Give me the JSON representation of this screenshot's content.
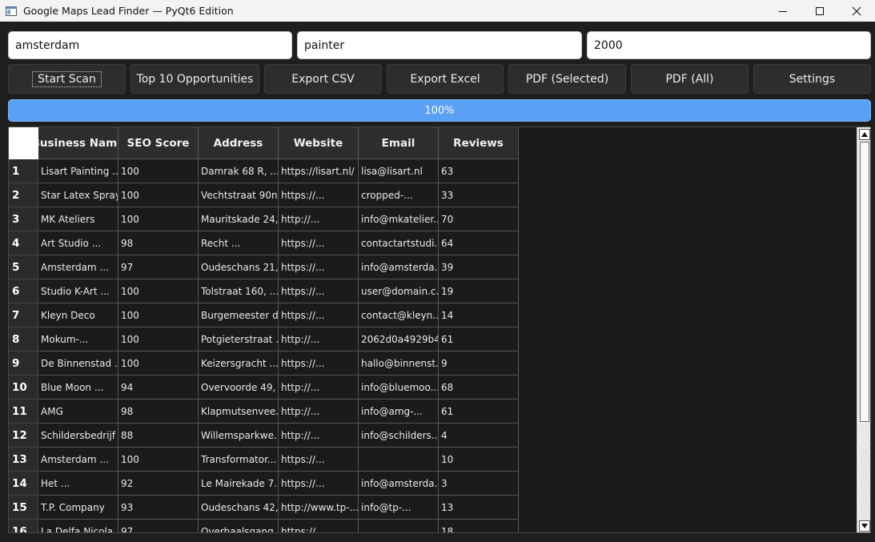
{
  "window": {
    "title": "Google Maps Lead Finder — PyQt6 Edition"
  },
  "inputs": {
    "location": "amsterdam",
    "keyword": "painter",
    "limit": "2000"
  },
  "toolbar": {
    "start_scan": "Start Scan",
    "top10": "Top 10 Opportunities",
    "export_csv": "Export CSV",
    "export_excel": "Export Excel",
    "pdf_selected": "PDF (Selected)",
    "pdf_all": "PDF (All)",
    "settings": "Settings"
  },
  "progress": {
    "value": 1.0,
    "label": "100%"
  },
  "table": {
    "columns": [
      "Business Name",
      "SEO Score",
      "Address",
      "Website",
      "Email",
      "Reviews"
    ],
    "rows": [
      {
        "n": "1",
        "name": "Lisart Painting ...",
        "seo": "100",
        "address": "Damrak 68 R, ...",
        "website": "https://lisart.nl/",
        "email": "lisa@lisart.nl",
        "reviews": "63"
      },
      {
        "n": "2",
        "name": "Star Latex Spray",
        "seo": "100",
        "address": "Vechtstraat 90n,...",
        "website": "https://...",
        "email": "cropped-...",
        "reviews": "33"
      },
      {
        "n": "3",
        "name": "MK Ateliers",
        "seo": "100",
        "address": "Mauritskade 24,...",
        "website": "http://...",
        "email": "info@mkatelier....",
        "reviews": "70"
      },
      {
        "n": "4",
        "name": "Art Studio ...",
        "seo": "98",
        "address": "Recht ...",
        "website": "https://...",
        "email": "contactartstudi...",
        "reviews": "64"
      },
      {
        "n": "5",
        "name": "Amsterdam ...",
        "seo": "97",
        "address": "Oudeschans 21,...",
        "website": "https://...",
        "email": "info@amsterda...",
        "reviews": "39"
      },
      {
        "n": "6",
        "name": "Studio K-Art ...",
        "seo": "100",
        "address": "Tolstraat 160, ...",
        "website": "https://...",
        "email": "user@domain.c...",
        "reviews": "19"
      },
      {
        "n": "7",
        "name": "Kleyn Deco",
        "seo": "100",
        "address": "Burgemeester d...",
        "website": "https://...",
        "email": "contact@kleyn....",
        "reviews": "14"
      },
      {
        "n": "8",
        "name": "Mokum-...",
        "seo": "100",
        "address": "Potgieterstraat ...",
        "website": "http://...",
        "email": "2062d0a4929b4...",
        "reviews": "61"
      },
      {
        "n": "9",
        "name": "De Binnenstad ...",
        "seo": "100",
        "address": "Keizersgracht ...",
        "website": "https://...",
        "email": "hallo@binnenst...",
        "reviews": "9"
      },
      {
        "n": "10",
        "name": "Blue Moon ...",
        "seo": "94",
        "address": "Overvoorde 49, ...",
        "website": "http://...",
        "email": "info@bluemoo....",
        "reviews": "68"
      },
      {
        "n": "11",
        "name": "AMG",
        "seo": "98",
        "address": "Klapmutsenvee...",
        "website": "http://...",
        "email": "info@amg-...",
        "reviews": "61"
      },
      {
        "n": "12",
        "name": "Schildersbedrijf ...",
        "seo": "88",
        "address": "Willemsparkwe...",
        "website": "http://...",
        "email": "info@schilders....",
        "reviews": "4"
      },
      {
        "n": "13",
        "name": "Amsterdam ...",
        "seo": "100",
        "address": "Transformator...",
        "website": "https://...",
        "email": "",
        "reviews": "10"
      },
      {
        "n": "14",
        "name": "Het ...",
        "seo": "92",
        "address": "Le Mairekade 7...",
        "website": "https://...",
        "email": "info@amsterda...",
        "reviews": "3"
      },
      {
        "n": "15",
        "name": "T.P. Company",
        "seo": "93",
        "address": "Oudeschans 42,...",
        "website": "http://www.tp-...",
        "email": "info@tp-...",
        "reviews": "13"
      },
      {
        "n": "16",
        "name": "La Delfa Nicola...",
        "seo": "97",
        "address": "Overhaalsgang ...",
        "website": "https://...",
        "email": "",
        "reviews": "18"
      }
    ]
  },
  "icons": {
    "app": "app-window-icon",
    "minimize": "minimize-icon",
    "maximize": "maximize-icon",
    "close": "close-icon",
    "scroll_up": "scroll-up-arrow-icon",
    "scroll_down": "scroll-down-arrow-icon"
  }
}
